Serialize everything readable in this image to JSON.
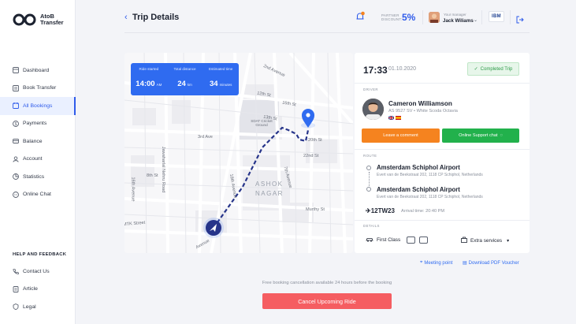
{
  "brand": {
    "name_line1": "AtoB",
    "name_line2": "Transfer"
  },
  "sidebar": {
    "items": [
      {
        "label": "Dashboard",
        "icon": "dashboard-icon"
      },
      {
        "label": "Book Transfer",
        "icon": "book-icon"
      },
      {
        "label": "All Bookings",
        "icon": "bookings-icon",
        "active": true
      },
      {
        "label": "Payments",
        "icon": "payments-icon"
      },
      {
        "label": "Balance",
        "icon": "balance-icon"
      },
      {
        "label": "Account",
        "icon": "account-icon"
      },
      {
        "label": "Statistics",
        "icon": "statistics-icon"
      },
      {
        "label": "Online Chat",
        "icon": "chat-icon"
      }
    ],
    "help_title": "HELP AND FEEDBACK",
    "help_items": [
      {
        "label": "Contact Us",
        "icon": "contact-icon"
      },
      {
        "label": "Article",
        "icon": "article-icon"
      },
      {
        "label": "Legal",
        "icon": "legal-icon"
      }
    ]
  },
  "header": {
    "back": "‹",
    "title": "Trip Details",
    "discount_label": "PARTNER DISCOUNT:",
    "discount_value": "5%",
    "manager_label": "Your manager",
    "manager_name": "Jack Wiliams",
    "company_logo": "IBM"
  },
  "map": {
    "stats": [
      {
        "label": "Ride started",
        "value": "14:00",
        "unit": "AM"
      },
      {
        "label": "Total distance",
        "value": "24",
        "unit": "km"
      },
      {
        "label": "Estimated time",
        "value": "34",
        "unit": "minutes"
      }
    ],
    "streets": [
      "2nd Avenue",
      "12th St",
      "13th St",
      "3rd Ave",
      "16th St",
      "20th St",
      "22nd St",
      "7th Avenue",
      "Jawaharlal Nehru Road",
      "8th St",
      "16th Avenue",
      "18th Avenue",
      "Murthy St",
      "SDAT Cricket Ground",
      "Avenue",
      "MTK Street"
    ],
    "area": [
      "ASHOK",
      "NAGAR"
    ]
  },
  "card": {
    "time": "17:33",
    "date": "01.10.2020",
    "status": "Completed Trip",
    "driver_title": "DRIVER",
    "driver_name": "Cameron Williamson",
    "driver_vehicle": "AS 9527 SV",
    "driver_car": "White Scoda Octavia",
    "comment_button": "Leave a comment",
    "support_button": "Online Support chat",
    "route_title": "ROUTE",
    "route": [
      {
        "name": "Amsterdam Schiphol Airport",
        "address": "Evert van de Beekstraat 202, 1118 CP Schiphol, Netherlands"
      },
      {
        "name": "Amsterdam Schiphol Airport",
        "address": "Evert van de Beekstraat 202, 1118 CP Schiphol, Netherlands"
      }
    ],
    "flight": "12TW23",
    "arrival": "Arrival time: 20:40 PM",
    "details_title": "DETAILS",
    "class": "First Class",
    "extra": "Extra services"
  },
  "links": {
    "meeting": "Meeting point",
    "pdf": "Download PDF Voucher"
  },
  "footnote": "Free booking cancellation available 24 hours before the booking",
  "cancel_button": "Cancel Upcoming Ride",
  "colors": {
    "accent": "#2f5bea",
    "map_blue": "#2f6bf0",
    "orange": "#f5831f",
    "green": "#22b14c",
    "cancel": "#f55d61",
    "navy": "#263a8a"
  }
}
